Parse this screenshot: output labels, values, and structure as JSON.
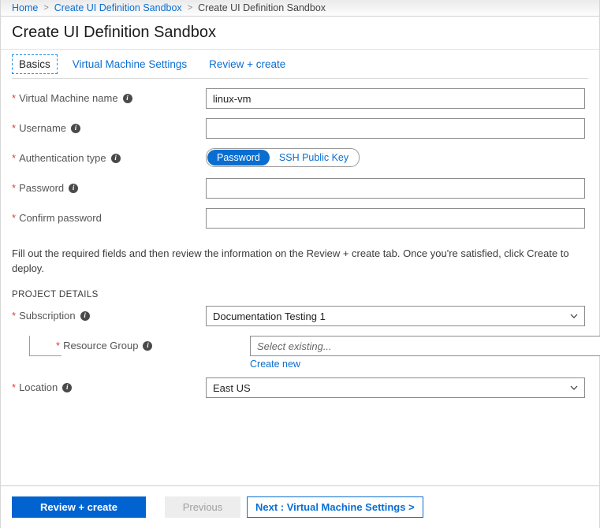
{
  "breadcrumb": {
    "items": [
      {
        "label": "Home",
        "link": true
      },
      {
        "label": "Create UI Definition Sandbox",
        "link": true
      },
      {
        "label": "Create UI Definition Sandbox",
        "link": false
      }
    ],
    "separator": ">"
  },
  "header": {
    "title": "Create UI Definition Sandbox"
  },
  "tabs": [
    {
      "label": "Basics",
      "active": true
    },
    {
      "label": "Virtual Machine Settings",
      "active": false
    },
    {
      "label": "Review + create",
      "active": false
    }
  ],
  "form": {
    "vm_name": {
      "label": "Virtual Machine name",
      "required": "*",
      "info": "i",
      "value": "linux-vm",
      "placeholder": ""
    },
    "username": {
      "label": "Username",
      "required": "*",
      "info": "i",
      "value": "",
      "placeholder": ""
    },
    "auth_type": {
      "label": "Authentication type",
      "required": "*",
      "info": "i",
      "options": [
        {
          "label": "Password",
          "selected": true
        },
        {
          "label": "SSH Public Key",
          "selected": false
        }
      ]
    },
    "password": {
      "label": "Password",
      "required": "*",
      "info": "i",
      "value": "",
      "placeholder": ""
    },
    "confirm_password": {
      "label": "Confirm password",
      "required": "*",
      "value": "",
      "placeholder": ""
    },
    "helper": "Fill out the required fields and then review the information on the Review + create tab. Once you're satisfied, click Create to deploy.",
    "section_title": "PROJECT DETAILS",
    "subscription": {
      "label": "Subscription",
      "required": "*",
      "info": "i",
      "value": "Documentation Testing 1"
    },
    "resource_group": {
      "label": "Resource Group",
      "required": "*",
      "info": "i",
      "value": "",
      "placeholder": "Select existing...",
      "create_new_link": "Create new"
    },
    "location": {
      "label": "Location",
      "required": "*",
      "info": "i",
      "value": "East US"
    }
  },
  "footer": {
    "review_create": "Review + create",
    "previous": "Previous",
    "next": "Next : Virtual Machine Settings >"
  },
  "colors": {
    "accent_blue": "#0a6ed1",
    "primary_button": "#0063cf",
    "required_red": "#e13c3c",
    "disabled_grey": "#ededed"
  }
}
